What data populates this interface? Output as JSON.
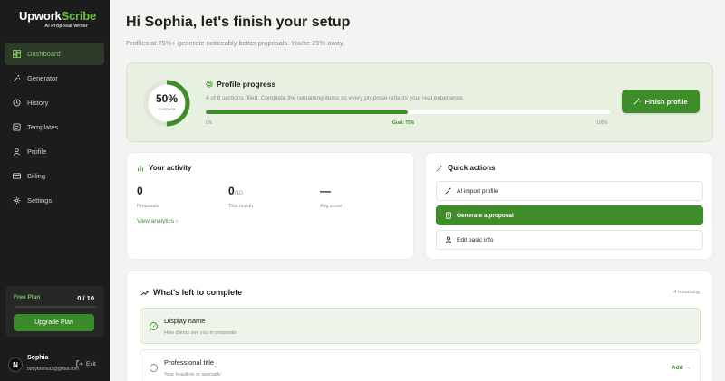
{
  "brand": {
    "name_part1": "Upwork",
    "name_part2": "Scribe",
    "tagline": "AI Proposal Writer"
  },
  "sidebar": {
    "items": [
      {
        "label": "Dashboard",
        "icon": "dashboard-icon",
        "active": true
      },
      {
        "label": "Generator",
        "icon": "wand-icon"
      },
      {
        "label": "History",
        "icon": "history-icon"
      },
      {
        "label": "Templates",
        "icon": "templates-icon"
      },
      {
        "label": "Profile",
        "icon": "user-icon"
      },
      {
        "label": "Billing",
        "icon": "card-icon"
      },
      {
        "label": "Settings",
        "icon": "gear-icon"
      }
    ],
    "plan": {
      "name": "Free Plan",
      "count": "0 / 10",
      "used_fraction": 0,
      "upgrade_label": "Upgrade Plan"
    },
    "user": {
      "initial": "N",
      "name": "Sophia",
      "email": "bobybrans92@gmail.com",
      "exit_label": "Exit"
    }
  },
  "header": {
    "greeting": "Hi Sophia, let's finish your setup",
    "subtitle": "Profiles at 75%+ generate noticeably better proposals. You're 25% away."
  },
  "progress": {
    "percent_label": "50%",
    "percent_value": 50,
    "caption": "complete",
    "title": "Profile progress",
    "description": "4 of 8 sections filled. Complete the remaining items so every proposal reflects your real experience.",
    "min_label": "0%",
    "goal_label": "Goal: 75%",
    "max_label": "100%",
    "finish_label": "Finish profile"
  },
  "activity": {
    "title": "Your activity",
    "stats": [
      {
        "value": "0",
        "denom": "",
        "label": "Proposals"
      },
      {
        "value": "0",
        "denom": "/10",
        "label": "This month"
      },
      {
        "value": "—",
        "denom": "",
        "label": "Avg score"
      }
    ],
    "view_label": "View analytics ›"
  },
  "quick_actions": {
    "title": "Quick actions",
    "buttons": [
      {
        "label": "AI import profile",
        "icon": "wand-icon"
      },
      {
        "label": "Generate a proposal",
        "icon": "document-icon"
      },
      {
        "label": "Edit basic info",
        "icon": "user-icon"
      }
    ]
  },
  "left_to_complete": {
    "title": "What's left to complete",
    "remaining": "4 remaining",
    "items": [
      {
        "title": "Display name",
        "subtitle": "How clients see you in proposals",
        "done": true,
        "action": ""
      },
      {
        "title": "Professional title",
        "subtitle": "Your headline or specialty",
        "done": false,
        "action": "Add →"
      }
    ]
  },
  "colors": {
    "accent": "#3f8d2a",
    "accent_light": "#7fc45d",
    "sidebar_bg": "#1b1c1b",
    "page_bg": "#f3f4f1"
  }
}
